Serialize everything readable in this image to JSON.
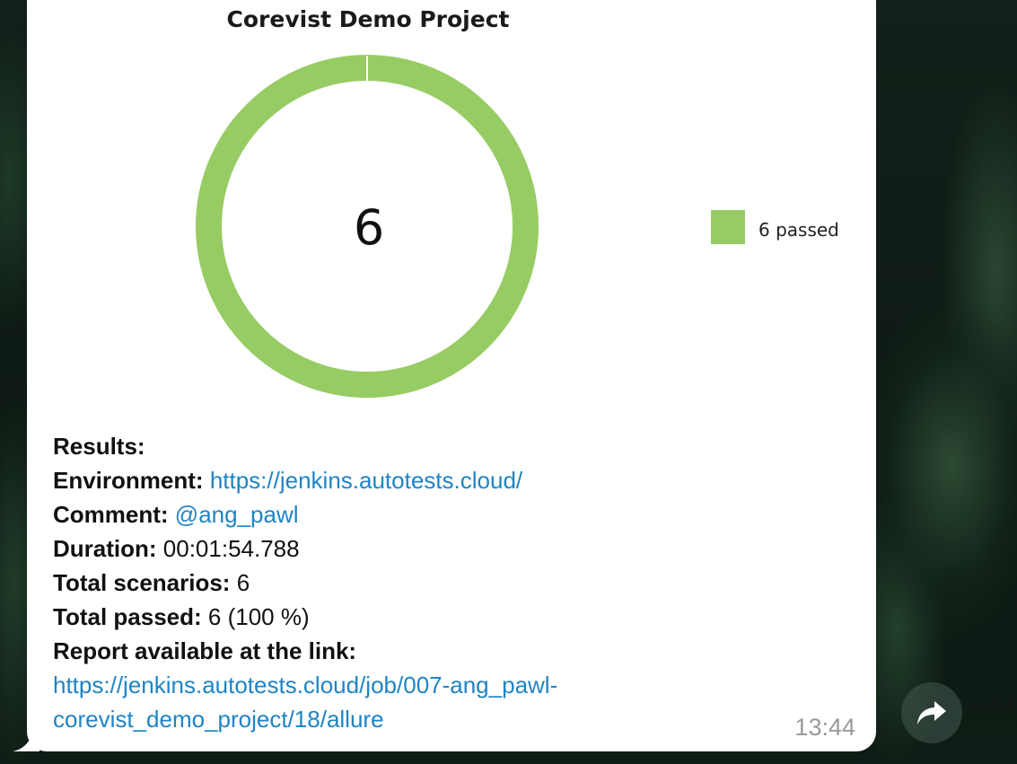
{
  "message": {
    "time": "13:44",
    "results_heading": "Results:",
    "environment_label": "Environment:",
    "environment_link": "https://jenkins.autotests.cloud/",
    "comment_label": "Comment:",
    "comment_mention": "@ang_pawl",
    "duration_label": "Duration:",
    "duration_value": "00:01:54.788",
    "total_scenarios_label": "Total scenarios:",
    "total_scenarios_value": "6",
    "total_passed_label": "Total passed:",
    "total_passed_value": "6 (100 %)",
    "report_label": "Report available at the link:",
    "report_link_line1": "https://jenkins.autotests.cloud/job/007-ang_pawl-",
    "report_link_line2": "corevist_demo_project/18/allure"
  },
  "chart_data": {
    "type": "pie",
    "title": "Corevist Demo Project",
    "center_label": "6",
    "categories": [
      "6 passed"
    ],
    "values": [
      6
    ],
    "colors": [
      "#97cc64"
    ],
    "legend": "right"
  },
  "icons": {
    "share": "share-arrow-icon"
  }
}
